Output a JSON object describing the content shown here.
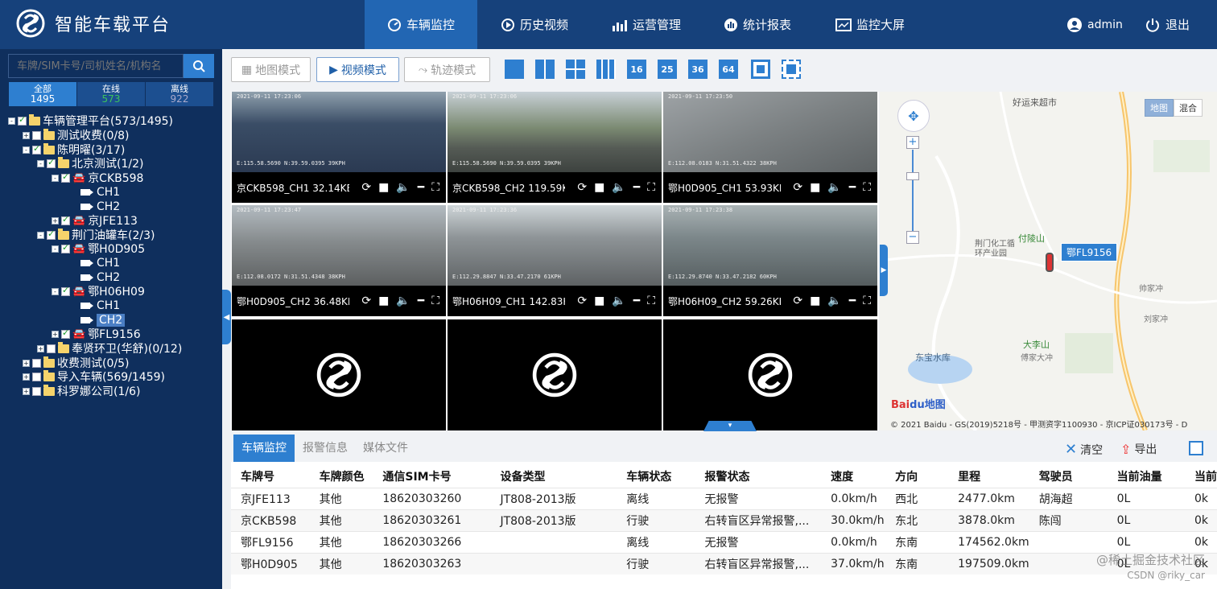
{
  "app": {
    "title": "智能车载平台",
    "user": "admin",
    "logout": "退出"
  },
  "nav": [
    {
      "label": "车辆监控",
      "icon": "speedometer-icon"
    },
    {
      "label": "历史视频",
      "icon": "play-circle-icon"
    },
    {
      "label": "运营管理",
      "icon": "chart-bars-icon"
    },
    {
      "label": "统计报表",
      "icon": "report-icon"
    },
    {
      "label": "监控大屏",
      "icon": "screen-icon"
    }
  ],
  "sidebar": {
    "search_placeholder": "车牌/SIM卡号/司机姓名/机构名",
    "stats": [
      {
        "label": "全部",
        "value": "1495"
      },
      {
        "label": "在线",
        "value": "573"
      },
      {
        "label": "离线",
        "value": "922"
      }
    ],
    "tree": [
      {
        "label": "车辆管理平台(573/1495)"
      },
      {
        "label": "测试收费(0/8)"
      },
      {
        "label": "陈明曜(3/17)"
      },
      {
        "label": "北京测试(1/2)"
      },
      {
        "label": "京CKB598"
      },
      {
        "label": "CH1"
      },
      {
        "label": "CH2"
      },
      {
        "label": "京JFE113"
      },
      {
        "label": "荆门油罐车(2/3)"
      },
      {
        "label": "鄂H0D905"
      },
      {
        "label": "CH1"
      },
      {
        "label": "CH2"
      },
      {
        "label": "鄂H06H09"
      },
      {
        "label": "CH1"
      },
      {
        "label": "CH2"
      },
      {
        "label": "鄂FL9156"
      },
      {
        "label": "奉贤环卫(华舒)(0/12)"
      },
      {
        "label": "收费测试(0/5)"
      },
      {
        "label": "导入车辆(569/1459)"
      },
      {
        "label": "科罗娜公司(1/6)"
      }
    ]
  },
  "modes": [
    "地图模式",
    "视频模式",
    "轨迹模式"
  ],
  "grid_buttons": [
    "16",
    "25",
    "36",
    "64"
  ],
  "videos": [
    {
      "label": "京CKB598_CH1 32.14KB/S",
      "stamp": "2021-09-11 17:23:06",
      "coords": "E:115.58.5690 N:39.59.0395 39KPH"
    },
    {
      "label": "京CKB598_CH2 119.59KB/S",
      "stamp": "2021-09-11 17:23:06",
      "coords": "E:115.58.5690 N:39.59.0395 39KPH"
    },
    {
      "label": "鄂H0D905_CH1 53.93KB/S",
      "stamp": "2021-09-11 17:23:50",
      "coords": "E:112.08.0183 N:31.51.4322 38KPH"
    },
    {
      "label": "鄂H0D905_CH2 36.48KB/S",
      "stamp": "2021-09-11 17:23:47",
      "coords": "E:112.08.0172 N:31.51.4348 38KPH"
    },
    {
      "label": "鄂H06H09_CH1 142.83KB/S",
      "stamp": "2021-09-11 17:23:36",
      "coords": "E:112.29.8847 N:33.47.2170 61KPH"
    },
    {
      "label": "鄂H06H09_CH2 59.26KB/S",
      "stamp": "2021-09-11 17:23:38",
      "coords": "E:112.29.8740 N:33.47.2182 60KPH"
    }
  ],
  "map": {
    "type_buttons": [
      "地图",
      "混合"
    ],
    "marker": "鄂FL9156",
    "places": [
      "好运来超市",
      "荆门化工循环产业园",
      "付陵山",
      "大李山",
      "东宝水库",
      "傅家大冲",
      "刘家冲",
      "帅家冲"
    ],
    "copyright": "© 2021 Baidu - GS(2019)5218号 - 甲测资字1100930 - 京ICP证030173号 - D"
  },
  "bottom": {
    "tabs": [
      "车辆监控",
      "报警信息",
      "媒体文件"
    ],
    "clear": "清空",
    "export": "导出",
    "columns": [
      "车牌号",
      "车牌颜色",
      "通信SIM卡号",
      "设备类型",
      "车辆状态",
      "报警状态",
      "速度",
      "方向",
      "里程",
      "驾驶员",
      "当前油量",
      "当前"
    ],
    "rows": [
      [
        "京JFE113",
        "其他",
        "18620303260",
        "JT808-2013版",
        "离线",
        "无报警",
        "0.0km/h",
        "西北",
        "2477.0km",
        "胡海超",
        "0L",
        "0k"
      ],
      [
        "京CKB598",
        "其他",
        "18620303261",
        "JT808-2013版",
        "行驶",
        "右转盲区异常报警,...",
        "30.0km/h",
        "东北",
        "3878.0km",
        "陈闯",
        "0L",
        "0k"
      ],
      [
        "鄂FL9156",
        "其他",
        "18620303266",
        "",
        "离线",
        "无报警",
        "0.0km/h",
        "东南",
        "174562.0km",
        "",
        "0L",
        "0k"
      ],
      [
        "鄂H0D905",
        "其他",
        "18620303263",
        "",
        "行驶",
        "右转盲区异常报警,...",
        "37.0km/h",
        "东南",
        "197509.0km",
        "",
        "0L",
        "0k"
      ]
    ]
  },
  "watermark": {
    "line1": "@稀土掘金技术社区",
    "line2": "CSDN @riky_car"
  }
}
